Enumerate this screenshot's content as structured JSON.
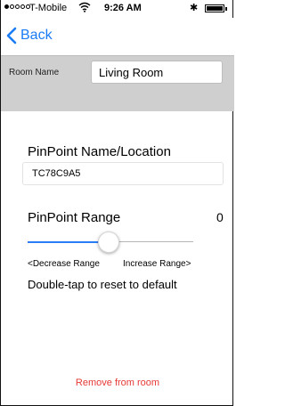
{
  "status_bar": {
    "carrier": "T-Mobile",
    "time": "9:26 AM",
    "bluetooth_icon": "bluetooth-icon",
    "signal_dots": [
      true,
      false,
      false,
      false,
      false
    ]
  },
  "nav": {
    "back_label": "Back",
    "accent": "#1a7cf5"
  },
  "room": {
    "label": "Room Name",
    "value": "Living Room"
  },
  "pinpoint": {
    "label": "PinPoint Name/Location",
    "value": "TC78C9A5"
  },
  "range": {
    "label": "PinPoint Range",
    "value": "0",
    "slider_fraction": 0.49,
    "decrease_label": "<Decrease Range",
    "increase_label": "Increase Range>",
    "hint": "Double-tap to reset to default"
  },
  "actions": {
    "remove_label": "Remove from room",
    "remove_color": "#e53935"
  }
}
